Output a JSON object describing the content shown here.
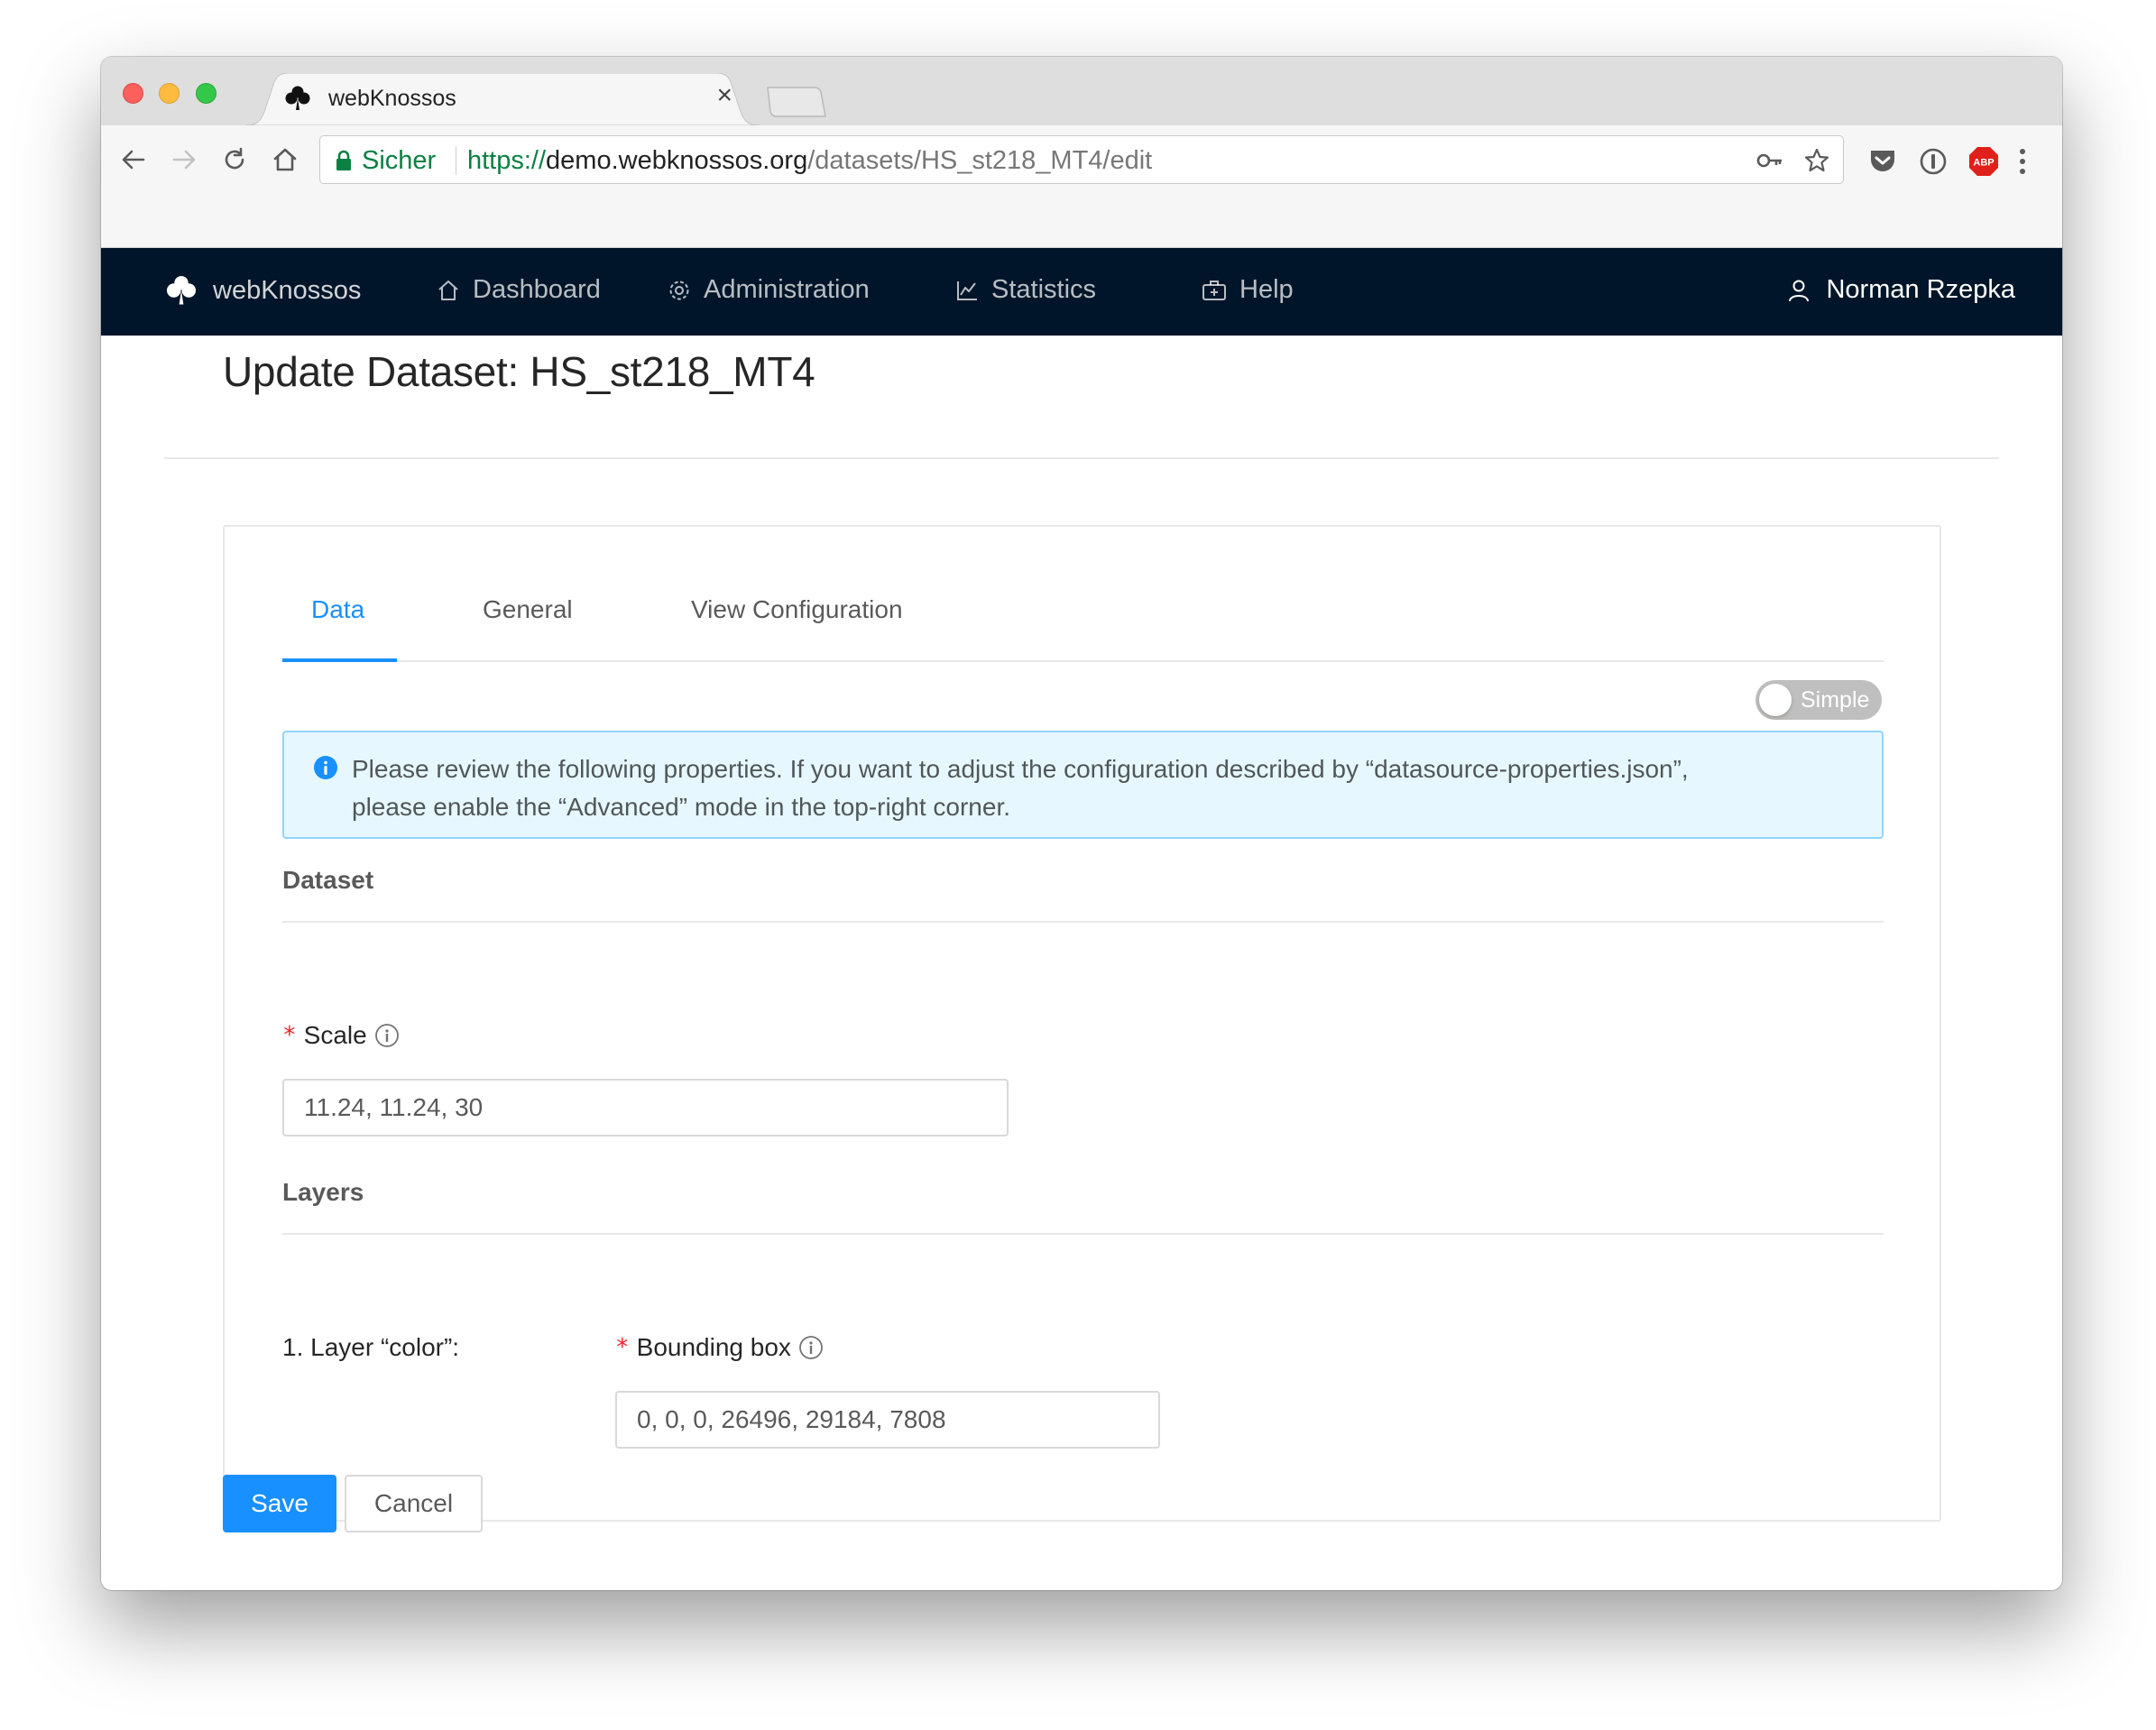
{
  "browser": {
    "tab_title": "webKnossos",
    "tab_close": "×",
    "secure_label": "Sicher",
    "url_scheme": "https://",
    "url_host": "demo.webknossos.org",
    "url_path": "/datasets/HS_st218_MT4/edit",
    "extension_abp": "ABP"
  },
  "navbar": {
    "brand": "webKnossos",
    "items": [
      {
        "label": "Dashboard",
        "icon": "home-icon"
      },
      {
        "label": "Administration",
        "icon": "gear-icon"
      },
      {
        "label": "Statistics",
        "icon": "line-chart-icon"
      },
      {
        "label": "Help",
        "icon": "medicine-box-icon"
      }
    ],
    "user": "Norman Rzepka"
  },
  "page": {
    "title": "Update Dataset: HS_st218_MT4"
  },
  "tabs": [
    {
      "label": "Data",
      "active": true
    },
    {
      "label": "General",
      "active": false
    },
    {
      "label": "View Configuration",
      "active": false
    }
  ],
  "mode_switch": {
    "label": "Simple",
    "checked": false
  },
  "alert": {
    "line1": "Please review the following properties. If you want to adjust the configuration described by “datasource-properties.json”,",
    "line2": "please enable the “Advanced” mode in the top-right corner."
  },
  "dataset_section": {
    "title": "Dataset",
    "scale_label": "Scale",
    "required_mark": "*",
    "scale_value": "11.24, 11.24, 30"
  },
  "layers_section": {
    "title": "Layers",
    "layer_label": "1. Layer “color”:",
    "bbox_label": "Bounding box",
    "bbox_value": "0, 0, 0, 26496, 29184, 7808"
  },
  "actions": {
    "save": "Save",
    "cancel": "Cancel"
  },
  "colors": {
    "primary": "#1890ff",
    "header_bg": "#001529",
    "alert_bg": "#e6f7ff",
    "required": "#f5222d",
    "secure_green": "#0b8043"
  }
}
